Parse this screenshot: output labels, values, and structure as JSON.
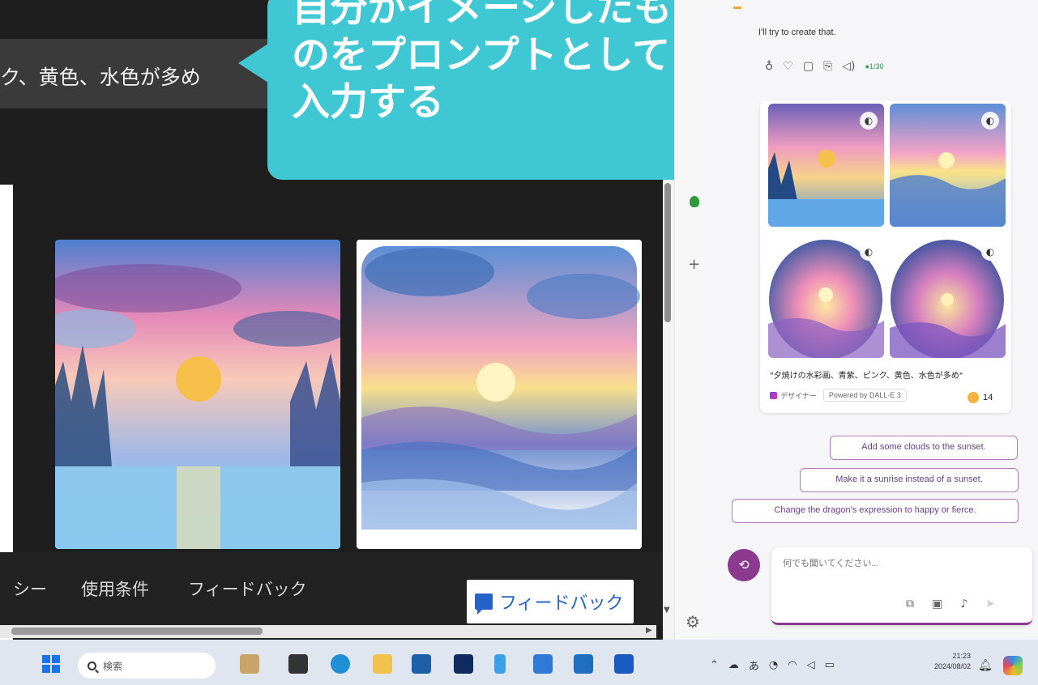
{
  "browser": {
    "prompt_text": "ク、黄色、水色が多め",
    "footer_links": [
      "シー",
      "使用条件",
      "フィードバック"
    ],
    "feedback_button": "フィードバック"
  },
  "callout": {
    "text": "自分がイメージしたものをプロンプトとして入力する"
  },
  "chat": {
    "reply": "I'll try to create that.",
    "counter": "●1/30",
    "caption": "\"夕焼けの水彩画、青紫、ピンク、黄色、水色が多め\"",
    "designer_label": "デザイナー",
    "powered_by": "Powered by DALL·E 3",
    "boost_count": "14",
    "suggestions": [
      "Add some clouds to the sunset.",
      "Make it a sunrise instead of a sunset.",
      "Change the dragon's expression to happy or fierce."
    ],
    "input_placeholder": "何でも聞いてください..."
  },
  "taskbar": {
    "search_placeholder": "検索",
    "clock_time": "21:23",
    "clock_date": "2024/08/02",
    "tray_ime": "あ"
  }
}
